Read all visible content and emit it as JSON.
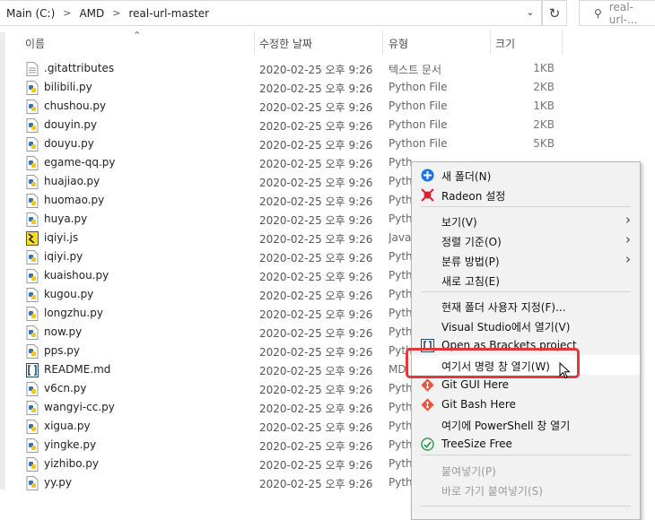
{
  "address_bar": {
    "breadcrumbs": [
      "Main (C:)",
      "AMD",
      "real-url-master"
    ]
  },
  "search": {
    "placeholder": "real-url-..."
  },
  "columns": {
    "name": "이름",
    "date": "수정한 날짜",
    "type": "유형",
    "size": "크기"
  },
  "files": [
    {
      "name": ".gitattributes",
      "date": "2020-02-25 오후 9:26",
      "type": "텍스트 문서",
      "size": "1KB",
      "icon": "text-file-icon"
    },
    {
      "name": "bilibili.py",
      "date": "2020-02-25 오후 9:26",
      "type": "Python File",
      "size": "2KB",
      "icon": "python-file-icon"
    },
    {
      "name": "chushou.py",
      "date": "2020-02-25 오후 9:26",
      "type": "Python File",
      "size": "1KB",
      "icon": "python-file-icon"
    },
    {
      "name": "douyin.py",
      "date": "2020-02-25 오후 9:26",
      "type": "Python File",
      "size": "2KB",
      "icon": "python-file-icon"
    },
    {
      "name": "douyu.py",
      "date": "2020-02-25 오후 9:26",
      "type": "Python File",
      "size": "5KB",
      "icon": "python-file-icon"
    },
    {
      "name": "egame-qq.py",
      "date": "2020-02-25 오후 9:26",
      "type": "Pyth",
      "size": "",
      "icon": "python-file-icon"
    },
    {
      "name": "huajiao.py",
      "date": "2020-02-25 오후 9:26",
      "type": "Pyth",
      "size": "",
      "icon": "python-file-icon"
    },
    {
      "name": "huomao.py",
      "date": "2020-02-25 오후 9:26",
      "type": "Pyth",
      "size": "",
      "icon": "python-file-icon"
    },
    {
      "name": "huya.py",
      "date": "2020-02-25 오후 9:26",
      "type": "Pyth",
      "size": "",
      "icon": "python-file-icon"
    },
    {
      "name": "iqiyi.js",
      "date": "2020-02-25 오후 9:26",
      "type": "Java",
      "size": "",
      "icon": "javascript-file-icon"
    },
    {
      "name": "iqiyi.py",
      "date": "2020-02-25 오후 9:26",
      "type": "Pyth",
      "size": "",
      "icon": "python-file-icon"
    },
    {
      "name": "kuaishou.py",
      "date": "2020-02-25 오후 9:26",
      "type": "Pyth",
      "size": "",
      "icon": "python-file-icon"
    },
    {
      "name": "kugou.py",
      "date": "2020-02-25 오후 9:26",
      "type": "Pyth",
      "size": "",
      "icon": "python-file-icon"
    },
    {
      "name": "longzhu.py",
      "date": "2020-02-25 오후 9:26",
      "type": "Pyth",
      "size": "",
      "icon": "python-file-icon"
    },
    {
      "name": "now.py",
      "date": "2020-02-25 오후 9:26",
      "type": "Pyth",
      "size": "",
      "icon": "python-file-icon"
    },
    {
      "name": "pps.py",
      "date": "2020-02-25 오후 9:26",
      "type": "Pyth",
      "size": "",
      "icon": "python-file-icon"
    },
    {
      "name": "README.md",
      "date": "2020-02-25 오후 9:26",
      "type": "MD",
      "size": "",
      "icon": "brackets-file-icon"
    },
    {
      "name": "v6cn.py",
      "date": "2020-02-25 오후 9:26",
      "type": "Pyth",
      "size": "",
      "icon": "python-file-icon"
    },
    {
      "name": "wangyi-cc.py",
      "date": "2020-02-25 오후 9:26",
      "type": "Pyth",
      "size": "",
      "icon": "python-file-icon"
    },
    {
      "name": "xigua.py",
      "date": "2020-02-25 오후 9:26",
      "type": "Pyth",
      "size": "",
      "icon": "python-file-icon"
    },
    {
      "name": "yingke.py",
      "date": "2020-02-25 오후 9:26",
      "type": "Pyth",
      "size": "",
      "icon": "python-file-icon"
    },
    {
      "name": "yizhibo.py",
      "date": "2020-02-25 오후 9:26",
      "type": "Pyth",
      "size": "",
      "icon": "python-file-icon"
    },
    {
      "name": "yy.py",
      "date": "2020-02-25 오후 9:26",
      "type": "Pyth",
      "size": "",
      "icon": "python-file-icon"
    }
  ],
  "context_menu": {
    "items": [
      {
        "label": "새 폴더(N)",
        "icon": "new-folder-icon"
      },
      {
        "label": "Radeon 설정",
        "icon": "radeon-icon"
      },
      {
        "label": "보기(V)",
        "submenu": true
      },
      {
        "label": "정렬 기준(O)",
        "submenu": true
      },
      {
        "label": "분류 방법(P)",
        "submenu": true
      },
      {
        "label": "새로 고침(E)"
      },
      {
        "label": "현재 폴더 사용자 지정(F)..."
      },
      {
        "label": "Visual Studio에서 열기(V)"
      },
      {
        "label": "Open as Brackets project",
        "icon": "brackets-icon"
      },
      {
        "label": "여기서 명령 창 열기(W)",
        "highlighted": true
      },
      {
        "label": "Git GUI Here",
        "icon": "git-icon"
      },
      {
        "label": "Git Bash Here",
        "icon": "git-icon"
      },
      {
        "label": "여기에 PowerShell 창 열기"
      },
      {
        "label": "TreeSize Free",
        "icon": "treesize-icon"
      },
      {
        "label": "붙여넣기(P)",
        "disabled": true
      },
      {
        "label": "바로 가기 붙여넣기(S)",
        "disabled": true
      }
    ]
  },
  "colors": {
    "highlight_box": "#e0383b",
    "python_blue": "#3572a5",
    "python_yellow": "#f5c518"
  }
}
